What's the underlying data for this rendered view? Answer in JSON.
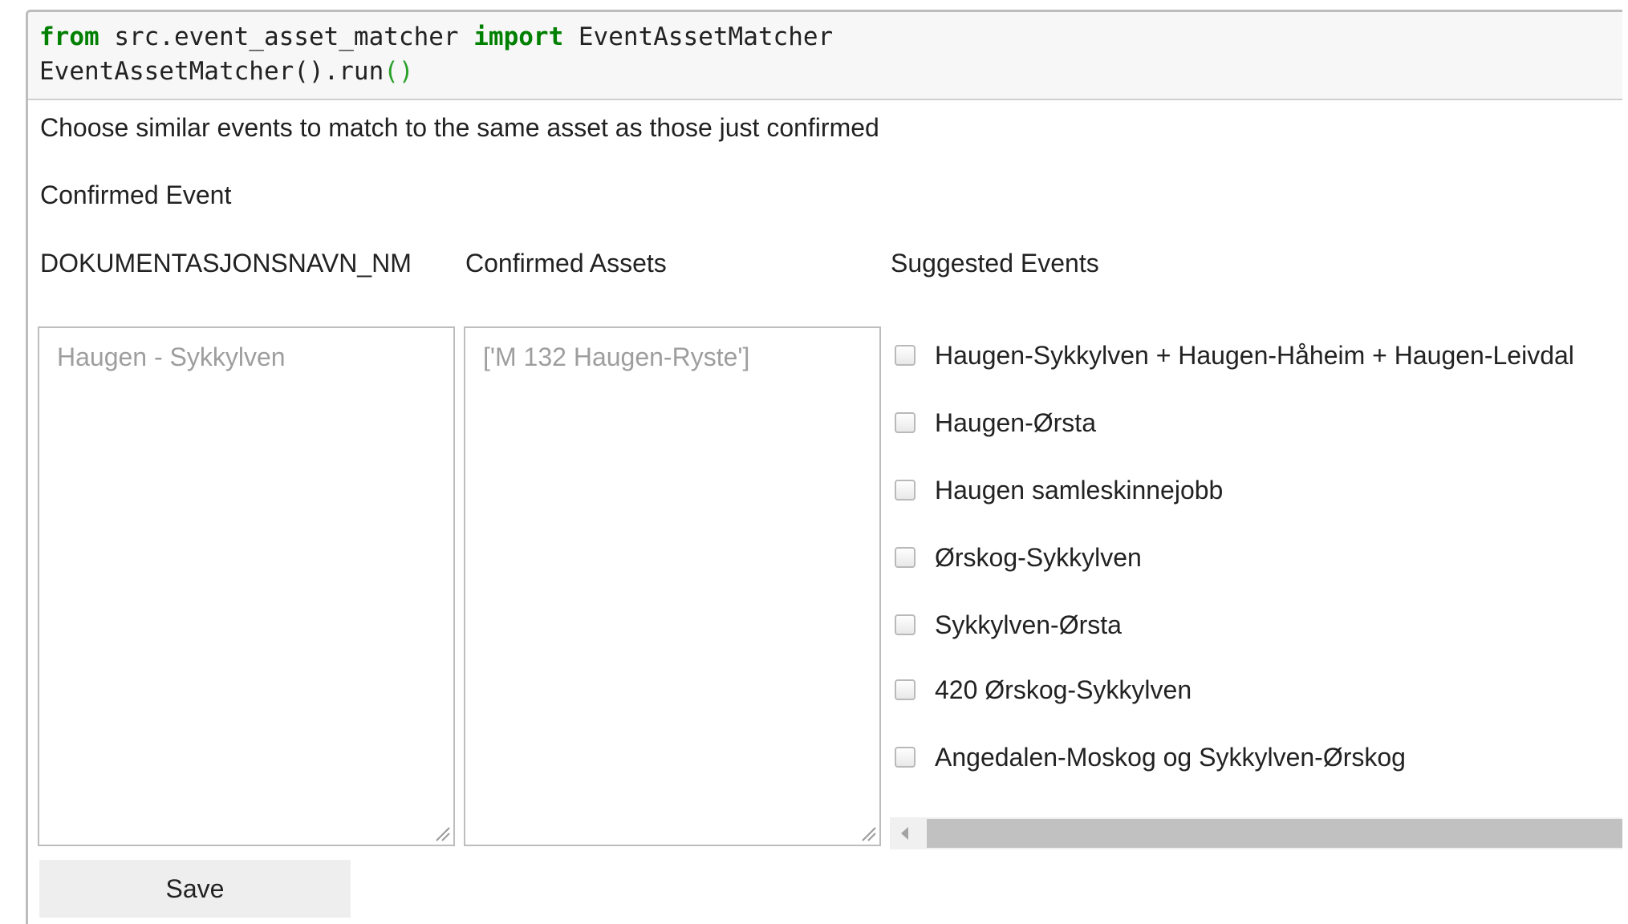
{
  "code": {
    "line1": {
      "kw_from": "from",
      "module": " src.event_asset_matcher ",
      "kw_import": "import",
      "name": " EventAssetMatcher"
    },
    "line2": {
      "call": "EventAssetMatcher().run",
      "parens": "()"
    }
  },
  "widget": {
    "instruction": "Choose similar events to match to the same asset as those just confirmed",
    "confirmed_event_heading": "Confirmed Event",
    "columns": {
      "doc_name_header": "DOKUMENTASJONSNAVN_NM",
      "assets_header": "Confirmed Assets",
      "suggested_header": "Suggested Events"
    },
    "doc_name_placeholder": "Haugen - Sykkylven",
    "assets_placeholder": "['M 132 Haugen-Ryste']",
    "suggested_events": [
      "Haugen-Sykkylven + Haugen-Håheim + Haugen-Leivdal",
      "Haugen-Ørsta",
      "Haugen samleskinnejobb",
      "Ørskog-Sykkylven",
      "Sykkylven-Ørsta",
      "420 Ørskog-Sykkylven",
      "Angedalen-Moskog og Sykkylven-Ørskog"
    ],
    "save_label": "Save"
  },
  "icons": {
    "resize": "resize-grip-icon",
    "scroll_left": "chevron-left-icon"
  }
}
